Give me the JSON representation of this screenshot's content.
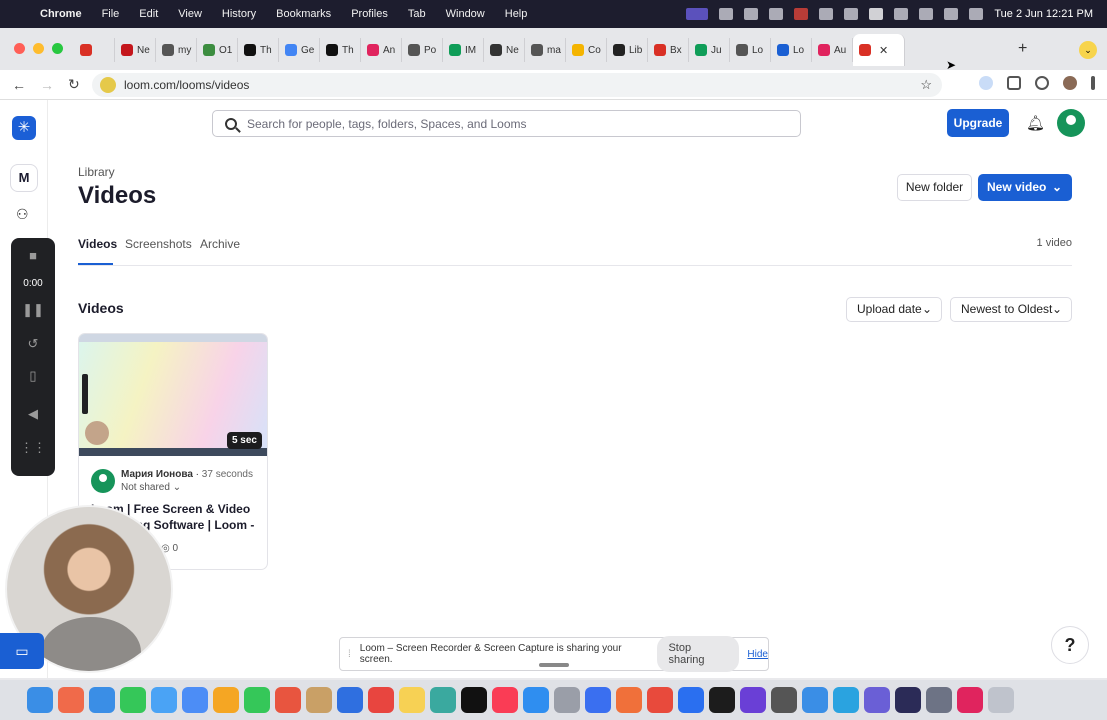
{
  "menubar": {
    "items": [
      "Chrome",
      "File",
      "Edit",
      "View",
      "History",
      "Bookmarks",
      "Profiles",
      "Tab",
      "Window",
      "Help"
    ],
    "clock": "Tue 2 Jun  12:21 PM"
  },
  "browser": {
    "tabs": [
      {
        "label": "",
        "color": "#d93025"
      },
      {
        "label": "Ne",
        "color": "#c4161c"
      },
      {
        "label": "my",
        "color": "#555555"
      },
      {
        "label": "O1",
        "color": "#3c8d40"
      },
      {
        "label": "Th",
        "color": "#111111"
      },
      {
        "label": "Ge",
        "color": "#4285f4"
      },
      {
        "label": "Th",
        "color": "#111111"
      },
      {
        "label": "An",
        "color": "#e0245e"
      },
      {
        "label": "Po",
        "color": "#555555"
      },
      {
        "label": "IM",
        "color": "#0f9d58"
      },
      {
        "label": "Ne",
        "color": "#333333"
      },
      {
        "label": "ma",
        "color": "#555555"
      },
      {
        "label": "Co",
        "color": "#f4b400"
      },
      {
        "label": "Lib",
        "color": "#222222"
      },
      {
        "label": "Bx",
        "color": "#d93025"
      },
      {
        "label": "Ju",
        "color": "#0f9d58"
      },
      {
        "label": "Lo",
        "color": "#555555"
      },
      {
        "label": "Lo",
        "color": "#1a5fd3"
      },
      {
        "label": "Au",
        "color": "#e0245e"
      }
    ],
    "active_tab": {
      "label": "",
      "color": "#d93025"
    },
    "url": "loom.com/looms/videos"
  },
  "loom": {
    "search_placeholder": "Search for people, tags, folders, Spaces, and Looms",
    "upgrade_label": "Upgrade",
    "workspace_initial": "M",
    "recorder": {
      "time": "0:00"
    },
    "library_label": "Library",
    "page_title": "Videos",
    "new_folder_label": "New folder",
    "new_video_label": "New video",
    "tabs": [
      "Videos",
      "Screenshots",
      "Archive"
    ],
    "video_count": "1 video",
    "section_title": "Videos",
    "sort_field": "Upload date",
    "sort_order": "Newest to Oldest",
    "video": {
      "duration": "5 sec",
      "owner": "Мария Ионова",
      "age": "37 seconds",
      "sharing": "Not shared",
      "title": "Loom | Free Screen & Video Recording Software | Loom - 2...",
      "views": "0"
    }
  },
  "share_bar": {
    "message": "Loom – Screen Recorder & Screen Capture is sharing your screen.",
    "stop_label": "Stop sharing",
    "hide_label": "Hide"
  },
  "help_label": "?",
  "dock": {
    "apps": [
      "#3a8ee6",
      "#f06a4a",
      "#3a8ee6",
      "#35c759",
      "#4aa3f5",
      "#4c8df6",
      "#f5a623",
      "#35c759",
      "#e8553f",
      "#c9a066",
      "#2f6fe0",
      "#e8453f",
      "#f7d154",
      "#3aa99f",
      "#111111",
      "#fa3c55",
      "#2f8ef0",
      "#9a9ea8",
      "#3a6ff0",
      "#f0703a",
      "#e84a3c",
      "#2a6ff0",
      "#1c1c1c",
      "#6a3fd6",
      "#555555",
      "#3a8ee6",
      "#2aa3e0",
      "#6a5fd6",
      "#2b2b57",
      "#6d7385",
      "#e0245e",
      "#bfc3cc"
    ]
  }
}
